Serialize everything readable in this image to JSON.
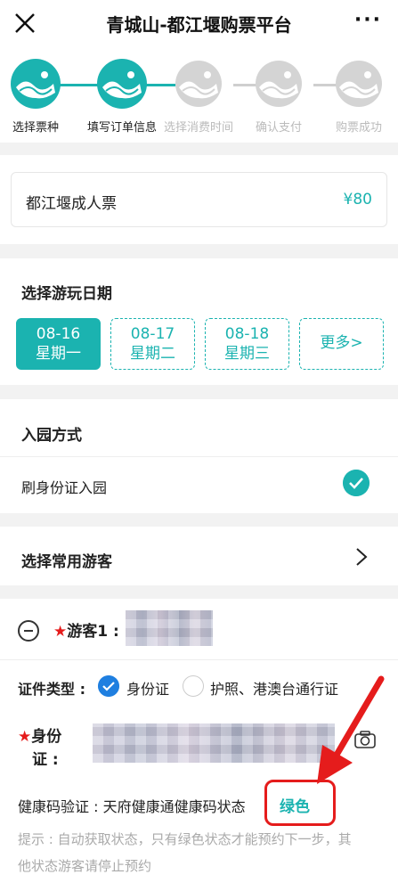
{
  "header": {
    "title": "青城山-都江堰购票平台",
    "close_icon": "close-icon",
    "more_label": "···"
  },
  "steps": [
    {
      "label": "选择票种",
      "state": "done"
    },
    {
      "label": "填写订单信息",
      "state": "done"
    },
    {
      "label": "选择消费时间",
      "state": "pending"
    },
    {
      "label": "确认支付",
      "state": "pending"
    },
    {
      "label": "购票成功",
      "state": "pending"
    }
  ],
  "ticket": {
    "name": "都江堰成人票",
    "price": "¥80"
  },
  "date_section": {
    "title": "选择游玩日期",
    "dates": [
      {
        "date": "08-16",
        "weekday": "星期一",
        "selected": true
      },
      {
        "date": "08-17",
        "weekday": "星期二",
        "selected": false
      },
      {
        "date": "08-18",
        "weekday": "星期三",
        "selected": false
      }
    ],
    "more_label": "更多>"
  },
  "entry_section": {
    "title": "入园方式",
    "option": "刷身份证入园"
  },
  "visitor_section": {
    "title": "选择常用游客"
  },
  "visitor": {
    "label": "游客1 :",
    "star": "★",
    "id_type_label": "证件类型 :",
    "id_options": [
      "身份证",
      "护照、港澳台通行证"
    ],
    "id_label_line1": "身份",
    "id_label_line2": "证 :",
    "health_label": "健康码验证 : 天府健康通健康码状态",
    "health_status": "绿色",
    "hint_line1": "提示 : 自动获取状态，只有绿色状态才能预约下一步，其",
    "hint_line2": "他状态游客请停止预约"
  },
  "colors": {
    "accent": "#1bb3b0",
    "highlight": "#e51c1c",
    "radio_on": "#1f7fe0"
  }
}
